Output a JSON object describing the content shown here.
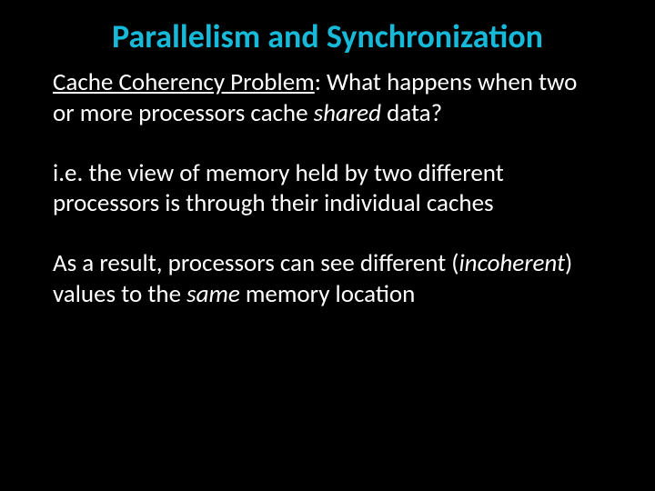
{
  "title": "Parallelism and Synchronization",
  "p1": {
    "lead": "Cache Coherency Problem",
    "rest1": ": What happens when two or more processors cache ",
    "shared": "shared",
    "rest2": " data?"
  },
  "p2": "i.e. the view of memory held by two different processors is through their individual caches",
  "p3": {
    "a": "As a result, processors can see different (",
    "incoherent": "incoherent",
    "b": ") values to the ",
    "same": "same",
    "c": " memory location"
  }
}
